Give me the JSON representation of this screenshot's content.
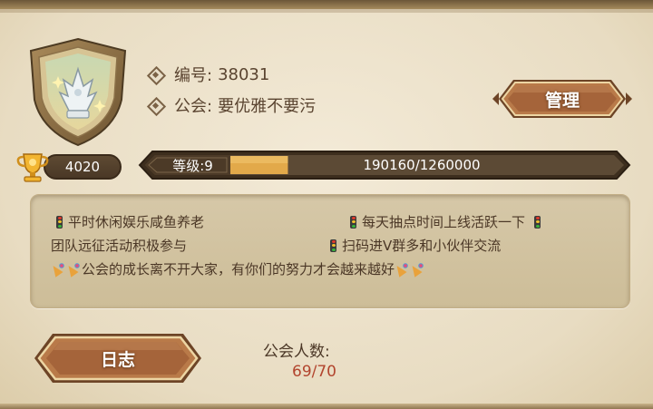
{
  "guild": {
    "id_label": "编号:",
    "id_value": "38031",
    "guild_label": "公会:",
    "guild_name": "要优雅不要污"
  },
  "buttons": {
    "manage_label": "管理",
    "log_label": "日志"
  },
  "trophy": {
    "value": "4020"
  },
  "level": {
    "label": "等级:9",
    "exp_text": "190160/1260000",
    "progress_fraction": 0.15
  },
  "notice": {
    "line1_left": "平时休闲娱乐咸鱼养老",
    "line1_right": "每天抽点时间上线活跃一下",
    "line2_left": "团队远征活动积极参与",
    "line2_right": "扫码进V群多和小伙伴交流",
    "line3": "公会的成长离不开大家，有你们的努力才会越来越好"
  },
  "members": {
    "label": "公会人数:",
    "value": "69/70"
  },
  "colors": {
    "button_brown": "#a5643a",
    "button_gold_border": "#e8cf98",
    "bar_fill": "#e2a94a"
  },
  "icons": {
    "emblem": "guild-shield-crown-icon",
    "trophy": "trophy-icon",
    "bullet": "diamond-bullet-icon"
  }
}
